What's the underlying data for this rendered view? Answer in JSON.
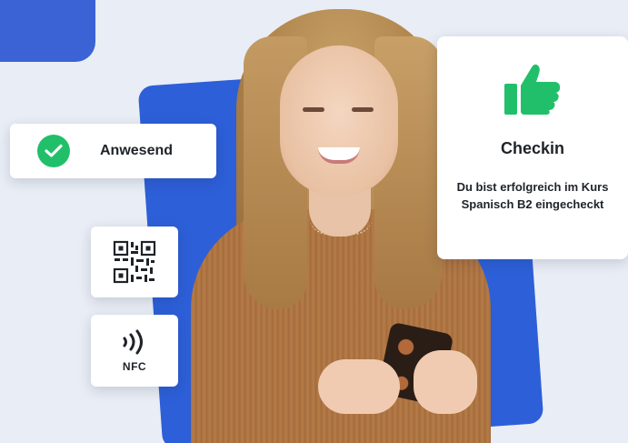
{
  "colors": {
    "background": "#e9edf5",
    "accent_blue": "#2d5fd8",
    "success_green": "#22bf6a",
    "card_bg": "#ffffff"
  },
  "attendance_card": {
    "icon": "check-circle-icon",
    "label": "Anwesend"
  },
  "qr_card": {
    "icon": "qr-code-icon"
  },
  "nfc_card": {
    "icon": "nfc-icon",
    "label": "NFC"
  },
  "checkin_card": {
    "icon": "thumbs-up-icon",
    "title": "Checkin",
    "message": "Du bist erfolgreich im Kurs Spanisch B2 eingecheckt"
  },
  "photo": {
    "subject": "woman-smiling-at-phone-image"
  }
}
